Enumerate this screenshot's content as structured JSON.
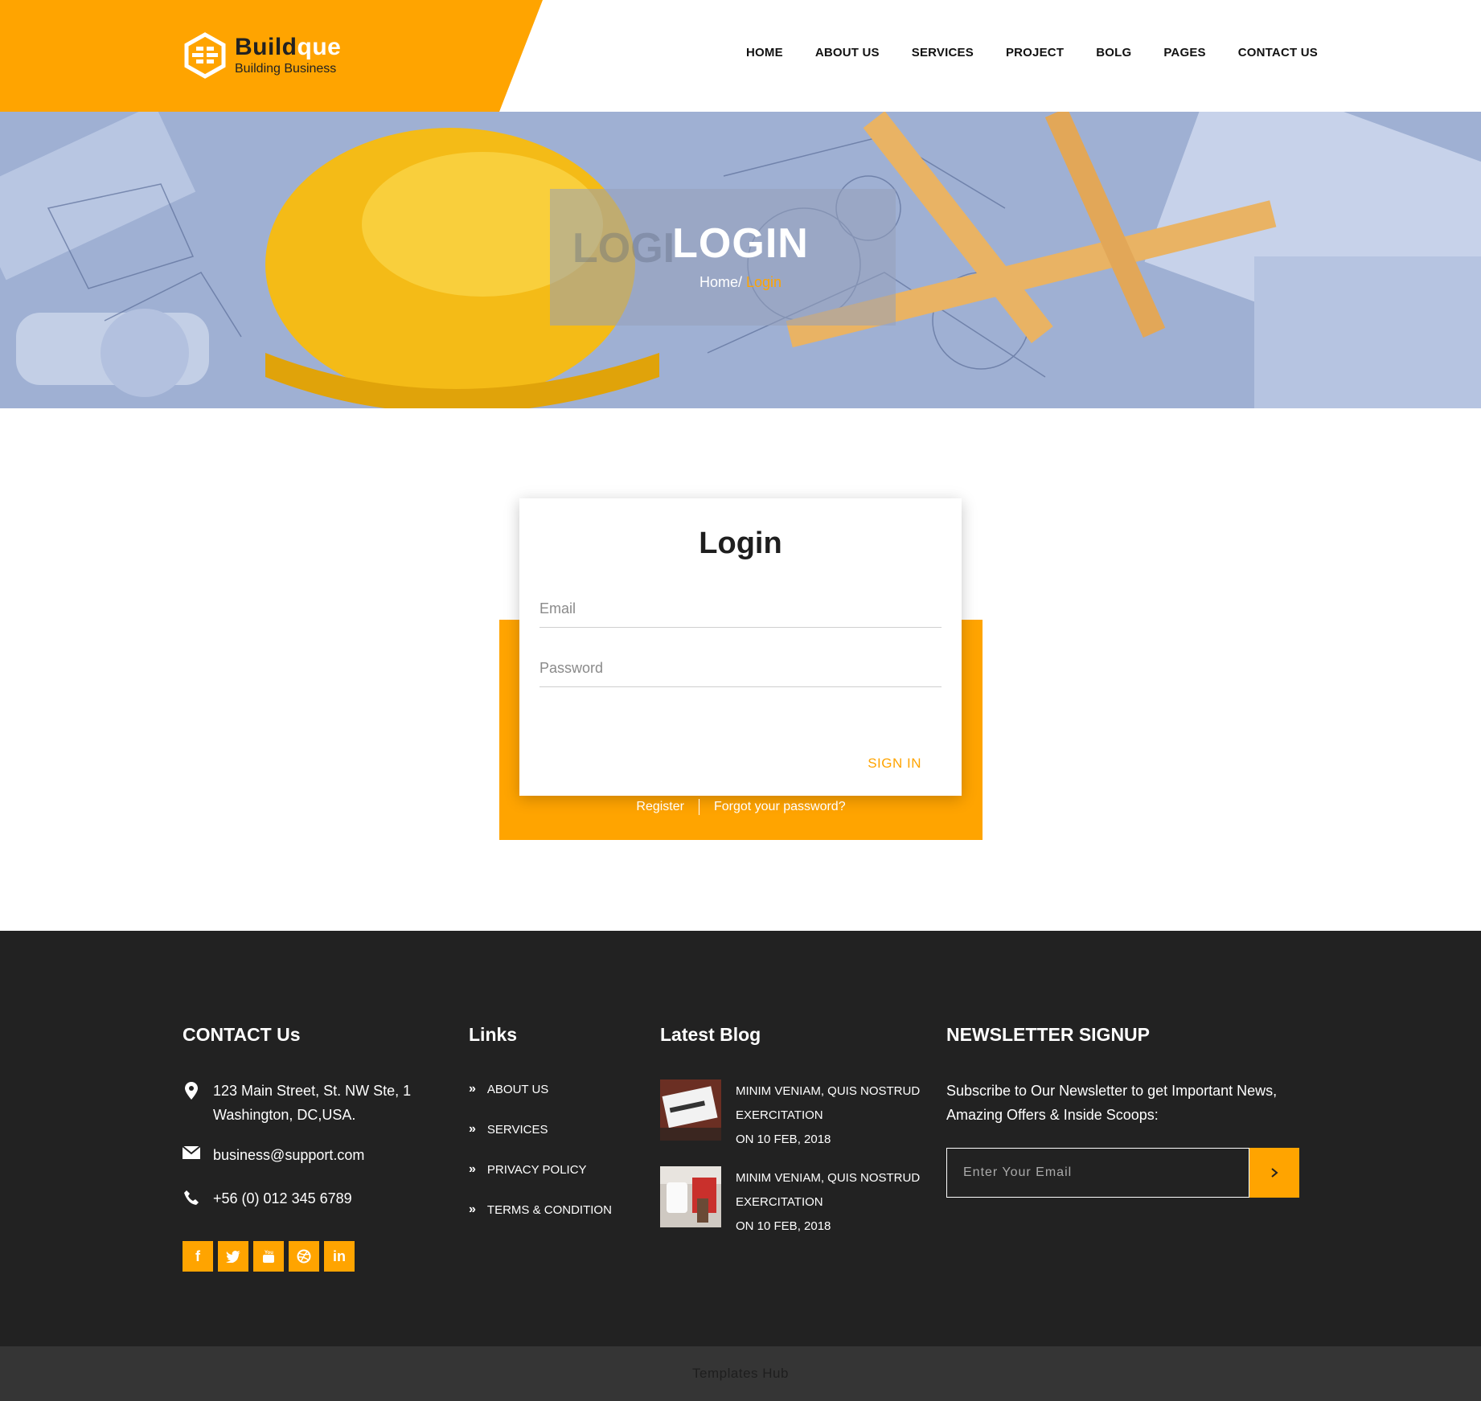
{
  "brand": {
    "title_part1": "Build",
    "title_part2": "que",
    "subtitle": "Building Business",
    "accent_color": "#ffa400"
  },
  "nav": {
    "items": [
      "HOME",
      "ABOUT US",
      "SERVICES",
      "PROJECT",
      "BOLG",
      "PAGES",
      "CONTACT US"
    ]
  },
  "hero": {
    "title": "LOGIN",
    "ghost": "LOGI",
    "breadcrumb_home": "Home/",
    "breadcrumb_current": "Login"
  },
  "login": {
    "title": "Login",
    "email_placeholder": "Email",
    "password_placeholder": "Password",
    "signin_label": "SIGN IN",
    "register_label": "Register",
    "forgot_label": "Forgot your password?"
  },
  "footer": {
    "contact": {
      "heading": "CONTACT Us",
      "address_line1": "123 Main Street, St. NW Ste, 1",
      "address_line2": "Washington, DC,USA.",
      "email": "business@support.com",
      "phone": "+56 (0) 012 345 6789",
      "social": [
        "facebook-icon",
        "twitter-icon",
        "youtube-icon",
        "dribbble-icon",
        "linkedin-icon"
      ]
    },
    "links": {
      "heading": "Links",
      "items": [
        "ABOUT US",
        "SERVICES",
        "PRIVACY POLICY",
        "TERMS & CONDITION"
      ]
    },
    "blog": {
      "heading": "Latest Blog",
      "posts": [
        {
          "line1": "MINIM VENIAM, QUIS NOSTRUD",
          "line2": "EXERCITATION",
          "date": "ON 10 FEB, 2018"
        },
        {
          "line1": "MINIM VENIAM, QUIS NOSTRUD",
          "line2": "EXERCITATION",
          "date": "ON 10 FEB, 2018"
        }
      ]
    },
    "newsletter": {
      "heading": "NEWSLETTER SIGNUP",
      "text": "Subscribe to Our Newsletter to get Important News, Amazing Offers & Inside Scoops:",
      "placeholder": "Enter Your Email"
    },
    "copyright": "Templates Hub"
  }
}
